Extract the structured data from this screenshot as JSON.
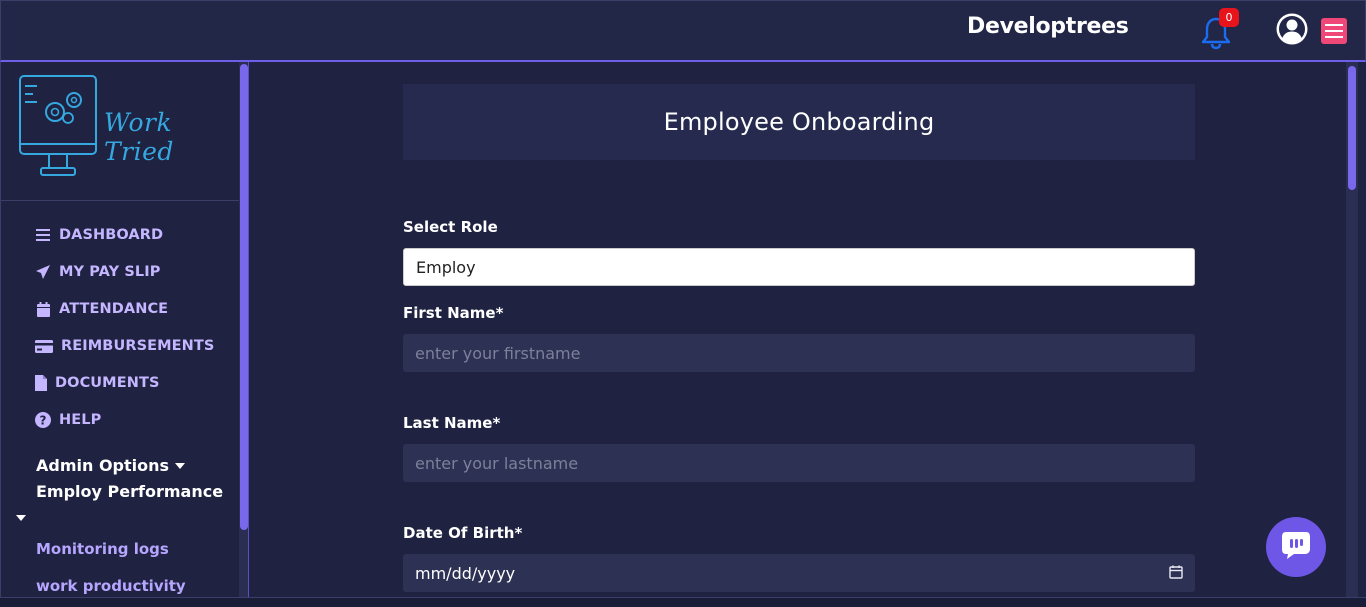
{
  "header": {
    "brand": "Developtrees",
    "notification_count": "0"
  },
  "sidebar": {
    "logo_text": "Work Tried",
    "items": [
      {
        "label": "DASHBOARD",
        "icon": "list-icon"
      },
      {
        "label": "MY PAY SLIP",
        "icon": "paper-plane-icon"
      },
      {
        "label": "ATTENDANCE",
        "icon": "calendar-icon"
      },
      {
        "label": "REIMBURSEMENTS",
        "icon": "credit-card-icon"
      },
      {
        "label": "DOCUMENTS",
        "icon": "file-icon"
      },
      {
        "label": "HELP",
        "icon": "question-circle-icon"
      }
    ],
    "admin_options": "Admin Options",
    "employ_performance": "Employ Performance",
    "sub_links": [
      "Monitoring logs",
      "work productivity"
    ]
  },
  "form": {
    "title": "Employee Onboarding",
    "select_role_label": "Select Role",
    "select_role_value": "Employ",
    "first_name_label": "First Name*",
    "first_name_placeholder": "enter your firstname",
    "last_name_label": "Last Name*",
    "last_name_placeholder": "enter your lastname",
    "dob_label": "Date Of Birth*",
    "dob_value": "mm/dd/yyyy"
  },
  "colors": {
    "background": "#1f2241",
    "accent": "#7a68ec",
    "nav_text": "#c4b6ff",
    "menu_button": "#ef4878",
    "badge": "#e8141c"
  }
}
